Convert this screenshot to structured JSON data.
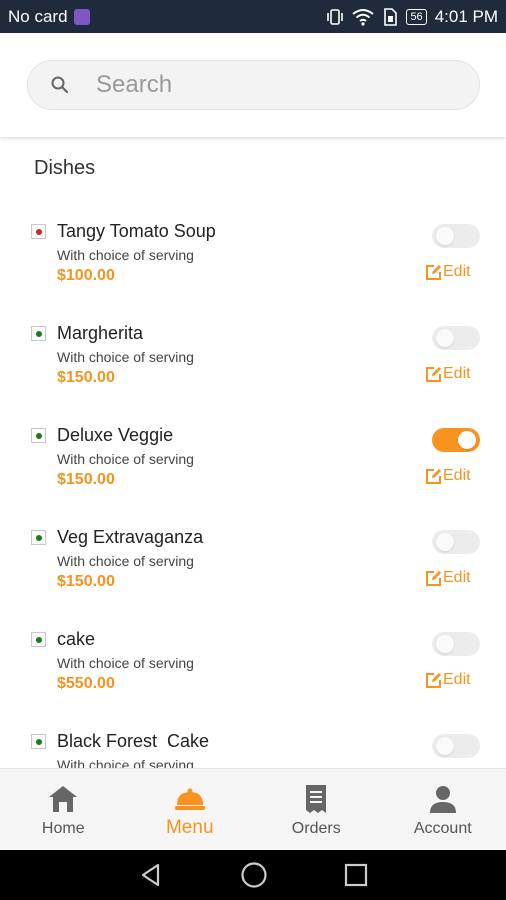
{
  "status_bar": {
    "carrier": "No card",
    "battery": "56",
    "time": "4:01 PM"
  },
  "search": {
    "placeholder": "Search",
    "value": ""
  },
  "section_title": "Dishes",
  "dishes": [
    {
      "name": "Tangy Tomato Soup",
      "description": "With choice of serving",
      "price": "$100.00",
      "veg": false,
      "enabled": false,
      "edit_label": "Edit"
    },
    {
      "name": "Margherita",
      "description": "With choice of serving",
      "price": "$150.00",
      "veg": true,
      "enabled": false,
      "edit_label": "Edit"
    },
    {
      "name": "Deluxe Veggie",
      "description": "With choice of serving",
      "price": "$150.00",
      "veg": true,
      "enabled": true,
      "edit_label": "Edit"
    },
    {
      "name": "Veg Extravaganza",
      "description": "With choice of serving",
      "price": "$150.00",
      "veg": true,
      "enabled": false,
      "edit_label": "Edit"
    },
    {
      "name": "cake",
      "description": "With choice of serving",
      "price": "$550.00",
      "veg": true,
      "enabled": false,
      "edit_label": "Edit"
    },
    {
      "name": "Black Forest  Cake",
      "description": "With choice of serving",
      "price": "",
      "veg": true,
      "enabled": false,
      "edit_label": ""
    }
  ],
  "bottom_nav": [
    {
      "label": "Home",
      "icon": "home-icon",
      "active": false
    },
    {
      "label": "Menu",
      "icon": "cloche-icon",
      "active": true
    },
    {
      "label": "Orders",
      "icon": "receipt-icon",
      "active": false
    },
    {
      "label": "Account",
      "icon": "person-icon",
      "active": false
    }
  ],
  "colors": {
    "accent": "#f7931e",
    "status_bar": "#1f2a3d",
    "veg_dot": "#1b7a1b",
    "nonveg_dot": "#c62828",
    "nav_text": "#555555"
  }
}
